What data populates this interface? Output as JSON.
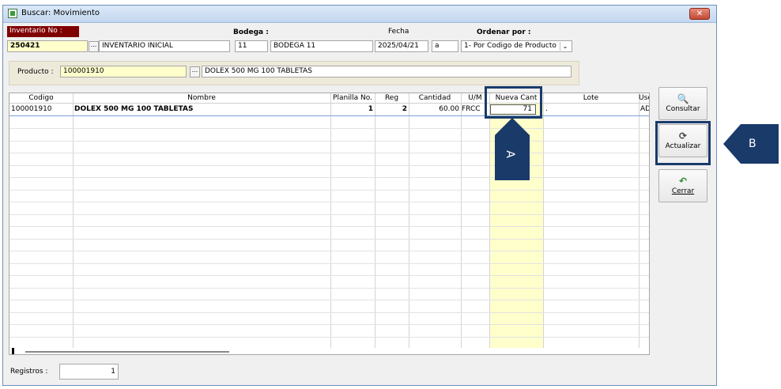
{
  "window": {
    "title": "Buscar: Movimiento"
  },
  "header": {
    "inventario_label": "Inventario No :",
    "inventario_value": "250421",
    "inventario_desc": "INVENTARIO INICIAL",
    "bodega_label": "Bodega :",
    "bodega_code": "11",
    "bodega_name": "BODEGA 11",
    "fecha_label": "Fecha",
    "fecha_value": "2025/04/21",
    "fecha_suffix": "a",
    "ordenar_label": "Ordenar por :",
    "ordenar_value": "1- Por Codigo de Producto"
  },
  "producto": {
    "label": "Producto :",
    "code": "100001910",
    "desc": "DOLEX 500 MG 100 TABLETAS"
  },
  "table": {
    "columns": [
      "Codigo",
      "Nombre",
      "Planilla No.",
      "Reg",
      "Cantidad",
      "U/M",
      "Nueva Cant",
      "Lote",
      "Use"
    ],
    "rows": [
      {
        "codigo": "100001910",
        "nombre": "DOLEX 500 MG 100 TABLETAS",
        "planilla": "1",
        "reg": "2",
        "cantidad": "60.00",
        "um": "FRCC",
        "nueva": "71",
        "lote": ".",
        "use": "AD"
      }
    ]
  },
  "buttons": {
    "consultar": "Consultar",
    "actualizar": "Actualizar",
    "cerrar": "Cerrar"
  },
  "footer": {
    "registros_label": "Registros :",
    "registros_value": "1"
  },
  "annotations": {
    "a": "A",
    "b": "B"
  },
  "colors": {
    "accent_dark": "#1a3a6a",
    "label_red": "#800000",
    "highlight_yellow": "#ffffcc"
  }
}
